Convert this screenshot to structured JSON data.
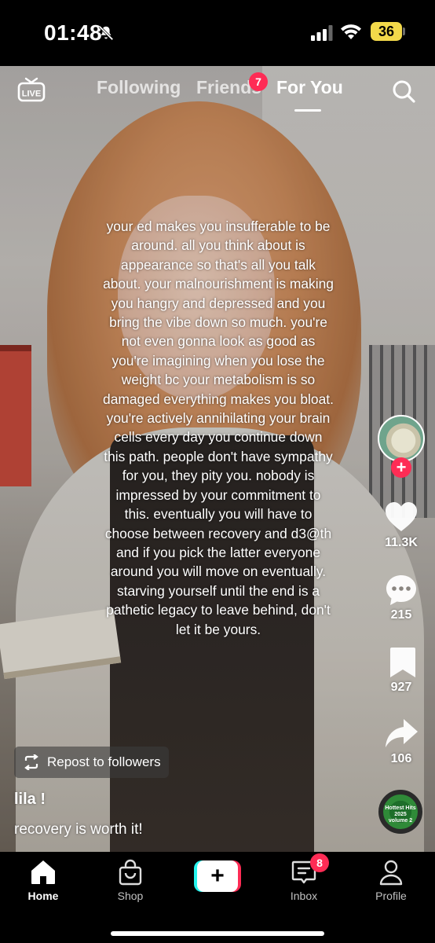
{
  "status_bar": {
    "time": "01:48",
    "battery": "36",
    "icons": [
      "bell-slash-icon",
      "signal-icon",
      "wifi-icon",
      "battery-icon"
    ]
  },
  "top_nav": {
    "live_label": "LIVE",
    "tabs": [
      {
        "label": "Following",
        "active": false
      },
      {
        "label": "Friends",
        "active": false,
        "badge": "7"
      },
      {
        "label": "For You",
        "active": true
      }
    ],
    "search_icon": "search-icon"
  },
  "caption": "your ed makes you insufferable to be around. all you think about is appearance so that's all you talk about. your malnourishment is making you hangry and depressed and you bring the vibe down so much. you're not even gonna look as good as you're imagining when you lose the weight bc your metabolism is so damaged everything makes you bloat. you're actively annihilating your brain cells every day you continue down this path. people don't have sympathy for you, they pity you. nobody is impressed by your commitment to this. eventually you will have to choose between recovery and d3@th and if you pick the latter everyone around you will move on eventually. starving yourself until the end is a pathetic legacy to leave behind, don't let it be yours.",
  "right_rail": {
    "follow_plus": "+",
    "likes": "11.3K",
    "comments": "215",
    "saves": "927",
    "shares": "106",
    "music_disc_text": [
      "Hottest Hits",
      "2025",
      "volume 2"
    ]
  },
  "repost_label": "Repost to followers",
  "username": "lila !",
  "description": "recovery is worth it!",
  "bottom_nav": {
    "home": "Home",
    "shop": "Shop",
    "create": "+",
    "inbox": "Inbox",
    "inbox_badge": "8",
    "profile": "Profile"
  },
  "colors": {
    "accent_red": "#fe2c55",
    "accent_cyan": "#25f4ee",
    "battery_yellow": "#f3d94a"
  }
}
